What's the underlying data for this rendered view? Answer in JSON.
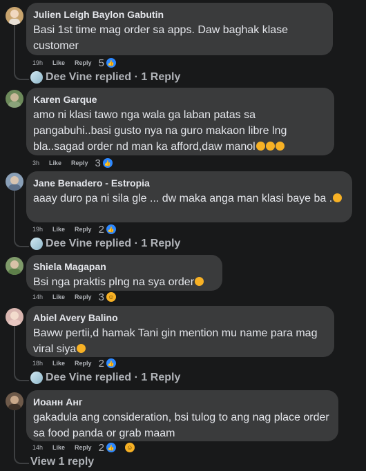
{
  "comments": [
    {
      "author": "Julien Leigh Baylon Gabutin",
      "text": "Basi 1st time mag order sa apps. Daw baghak klase customer",
      "time": "19h",
      "like": "Like",
      "reply": "Reply",
      "count": "5",
      "reactions": [
        "like"
      ],
      "replies": "Dee Vine replied · 1 Reply",
      "avatar_color": "#c8a46e"
    },
    {
      "author": "Karen Garque",
      "text": "amo ni klasi tawo nga wala ga laban patas sa pangabuhi..basi gusto nya na guro makaon libre lng bla..sagad order nd man ka afford,daw manol",
      "time": "3h",
      "like": "Like",
      "reply": "Reply",
      "count": "3",
      "reactions": [
        "like"
      ],
      "avatar_color": "#6d8a5b"
    },
    {
      "author": "Jane Benadero - Estropia",
      "text": "aaay duro pa ni sila gle ... dw maka anga man klasi baye ba .",
      "time": "19h",
      "like": "Like",
      "reply": "Reply",
      "count": "2",
      "reactions": [
        "like"
      ],
      "replies": "Dee Vine replied · 1 Reply",
      "avatar_color": "#8aa0b8"
    },
    {
      "author": "Shiela Magapan",
      "text": "Bsi nga praktis plng na sya order",
      "time": "14h",
      "like": "Like",
      "reply": "Reply",
      "count": "3",
      "reactions": [
        "haha"
      ],
      "avatar_color": "#7f9a6a"
    },
    {
      "author": "Abiel Avery Balino",
      "text": "Baww pertii,d hamak Tani gin mention mu name para mag viral siya",
      "time": "18h",
      "like": "Like",
      "reply": "Reply",
      "count": "2",
      "reactions": [
        "like"
      ],
      "replies": "Dee Vine replied · 1 Reply",
      "avatar_color": "#d9b6b0"
    },
    {
      "author": "Иоанн Анг",
      "text": "gakadula ang consideration, bsi tulog to ang nag place order sa food panda or grab maam",
      "time": "14h",
      "like": "Like",
      "reply": "Reply",
      "count": "2",
      "reactions": [
        "like",
        "haha"
      ],
      "avatar_color": "#6e5a4a"
    }
  ],
  "view_reply": "View 1 reply",
  "colors": {
    "bg": "#18191a",
    "bubble": "#3a3b3c",
    "text": "#e4e6eb",
    "muted": "#b0b3b8",
    "like_blue": "#2d88ff",
    "emoji_yellow": "#f7b125"
  }
}
